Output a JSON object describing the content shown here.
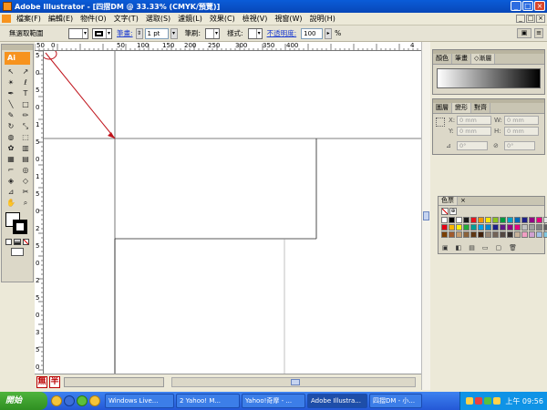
{
  "window": {
    "title": "Adobe Illustrator - [四摺DM @ 33.33% (CMYK/預覽)]",
    "min": "_",
    "max": "□",
    "close": "×"
  },
  "menu": {
    "items": [
      "檔案(F)",
      "編輯(E)",
      "物件(O)",
      "文字(T)",
      "選取(S)",
      "濾鏡(L)",
      "效果(C)",
      "檢視(V)",
      "視窗(W)",
      "說明(H)"
    ],
    "mdi": [
      "_",
      "□",
      "×"
    ]
  },
  "control": {
    "selection": "無選取範圍",
    "stroke_label": "筆畫:",
    "stroke_weight": "1 pt",
    "brush_label": "筆刷:",
    "style_label": "樣式:",
    "opacity_label": "不透明度:",
    "opacity_value": "100",
    "percent": "%"
  },
  "tools": {
    "logo": "Ai",
    "items": [
      {
        "name": "selection-tool-icon",
        "g": "↖"
      },
      {
        "name": "direct-selection-tool-icon",
        "g": "↗"
      },
      {
        "name": "magic-wand-tool-icon",
        "g": "✴"
      },
      {
        "name": "lasso-tool-icon",
        "g": "ℓ"
      },
      {
        "name": "pen-tool-icon",
        "g": "✒"
      },
      {
        "name": "type-tool-icon",
        "g": "T"
      },
      {
        "name": "line-tool-icon",
        "g": "╲"
      },
      {
        "name": "rectangle-tool-icon",
        "g": "□"
      },
      {
        "name": "paintbrush-tool-icon",
        "g": "✎"
      },
      {
        "name": "pencil-tool-icon",
        "g": "✏"
      },
      {
        "name": "rotate-tool-icon",
        "g": "↻"
      },
      {
        "name": "scale-tool-icon",
        "g": "⤡"
      },
      {
        "name": "warp-tool-icon",
        "g": "◍"
      },
      {
        "name": "free-transform-tool-icon",
        "g": "⬚"
      },
      {
        "name": "symbol-sprayer-tool-icon",
        "g": "✿"
      },
      {
        "name": "column-graph-tool-icon",
        "g": "▥"
      },
      {
        "name": "mesh-tool-icon",
        "g": "▦"
      },
      {
        "name": "gradient-tool-icon",
        "g": "▤"
      },
      {
        "name": "eyedropper-tool-icon",
        "g": "⌐"
      },
      {
        "name": "blend-tool-icon",
        "g": "◎"
      },
      {
        "name": "live-paint-tool-icon",
        "g": "◈"
      },
      {
        "name": "live-paint-selection-tool-icon",
        "g": "◇"
      },
      {
        "name": "slice-tool-icon",
        "g": "⊿"
      },
      {
        "name": "scissors-tool-icon",
        "g": "✂"
      },
      {
        "name": "hand-tool-icon",
        "g": "✋"
      },
      {
        "name": "zoom-tool-icon",
        "g": "⌕"
      }
    ]
  },
  "rulers": {
    "top": [
      "50",
      "0",
      "50",
      "100",
      "150",
      "200",
      "250",
      "300",
      "350",
      "400",
      "4"
    ],
    "left": [
      "5",
      "0",
      "5",
      "0",
      "1",
      "5",
      "0",
      "1",
      "5",
      "0",
      "2",
      "5",
      "0",
      "2",
      "5",
      "0",
      "3",
      "5",
      "0"
    ]
  },
  "status": {
    "btn1": "無",
    "btn2": "半"
  },
  "panels": {
    "color_tabs": [
      "顏色",
      "筆畫",
      "◇漸層"
    ],
    "transform_tabs": [
      "圖層",
      "變形",
      "對齊"
    ],
    "x_label": "X:",
    "y_label": "Y:",
    "w_label": "W:",
    "h_label": "H:",
    "x_val": "0 mm",
    "y_val": "0 mm",
    "w_val": "0 mm",
    "h_val": "0 mm",
    "rot_val": "0°",
    "shear_val": "0°",
    "swatch_tabs": [
      "色票"
    ],
    "swatch_close": "×",
    "swatches": [
      "#ffffff",
      "#000000",
      "#ffffff",
      "#1a1a1a",
      "#e8141c",
      "#f29600",
      "#ffe600",
      "#8dc21f",
      "#009a3e",
      "#00a1c7",
      "#0068b7",
      "#1d2088",
      "#920783",
      "#e4007f",
      "#e5e5e5",
      "#e50012",
      "#f8b500",
      "#fff100",
      "#22ac38",
      "#009e96",
      "#00a0e9",
      "#0086d1",
      "#1d2088",
      "#601986",
      "#920783",
      "#e4007f",
      "#c0c0c0",
      "#a0a0a0",
      "#808080",
      "#606060",
      "#7b3f00",
      "#a05a2c",
      "#c69c6d",
      "#8c6239",
      "#603813",
      "#42210b",
      "#998675",
      "#736357",
      "#534741",
      "#362f2d",
      "#c7b299",
      "#f19ec2",
      "#d0a0d0",
      "#a0c0e8",
      "#80c8e0"
    ]
  },
  "taskbar": {
    "start": "開始",
    "buttons": [
      "Windows Live...",
      "2 Yahoo! M...",
      "Yahoo!奇摩 - ...",
      "Adobe Illustra...",
      "四摺DM - 小..."
    ],
    "clock": "上午 09:56"
  }
}
